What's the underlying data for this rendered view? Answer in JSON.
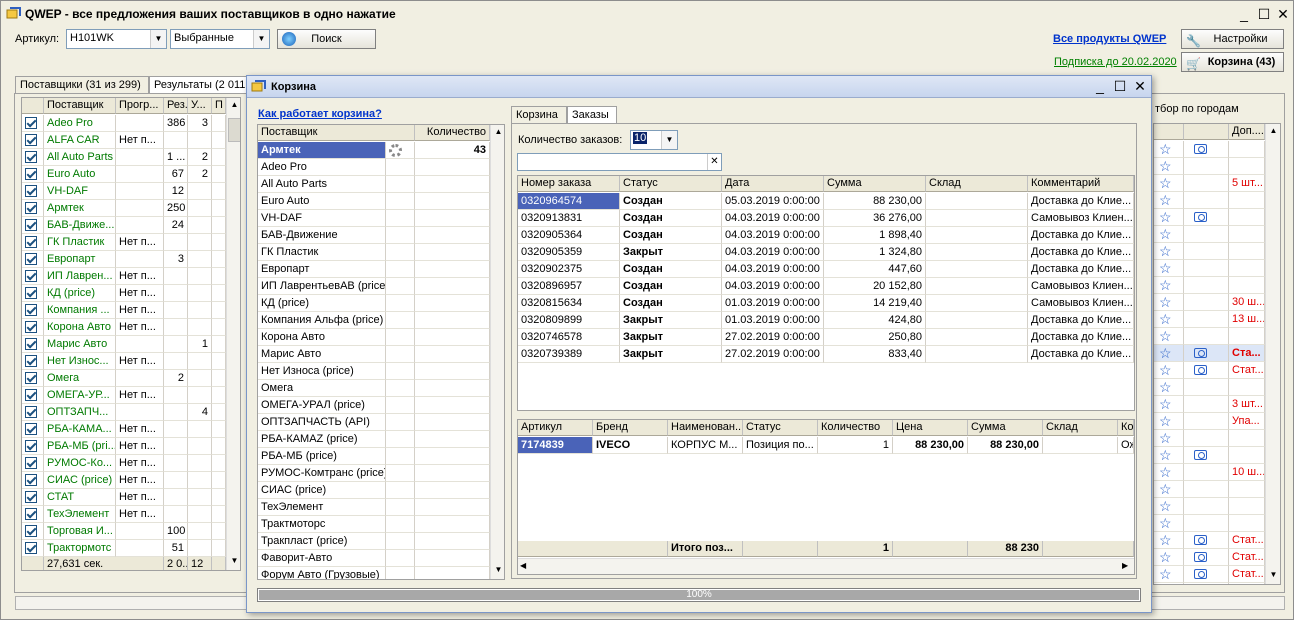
{
  "window": {
    "title": "QWEP - все предложения ваших поставщиков в одно нажатие"
  },
  "toolbar": {
    "article_label": "Артикул:",
    "article_value": "H101WK",
    "filter_value": "Выбранные",
    "search_label": "Поиск",
    "all_products_link": "Все продукты QWEP",
    "settings_label": "Настройки",
    "subscription_link": "Подписка до 20.02.2020",
    "cart_label": "Корзина (43)"
  },
  "main_tabs": [
    "Поставщики (31 из 299)",
    "Результаты (2 011"
  ],
  "suppliers_grid": {
    "headers": [
      "Поставщик",
      "Прогр...",
      "Рез...",
      "У...",
      "П"
    ],
    "rows": [
      {
        "name": "Adeo Pro",
        "prog": "",
        "res": "386",
        "u": "3"
      },
      {
        "name": "ALFA CAR",
        "prog": "Нет п...",
        "res": "",
        "u": ""
      },
      {
        "name": "All Auto Parts",
        "prog": "",
        "res": "1 ...",
        "u": "2"
      },
      {
        "name": "Euro Auto",
        "prog": "",
        "res": "67",
        "u": "2"
      },
      {
        "name": "VH-DAF",
        "prog": "",
        "res": "12",
        "u": ""
      },
      {
        "name": "Армтек",
        "prog": "",
        "res": "250",
        "u": ""
      },
      {
        "name": "БАВ-Движе...",
        "prog": "",
        "res": "24",
        "u": ""
      },
      {
        "name": "ГК Пластик",
        "prog": "Нет п...",
        "res": "",
        "u": ""
      },
      {
        "name": "Европарт",
        "prog": "",
        "res": "3",
        "u": ""
      },
      {
        "name": "ИП Лаврен...",
        "prog": "Нет п...",
        "res": "",
        "u": ""
      },
      {
        "name": "КД (price)",
        "prog": "Нет п...",
        "res": "",
        "u": ""
      },
      {
        "name": "Компания ...",
        "prog": "Нет п...",
        "res": "",
        "u": ""
      },
      {
        "name": "Корона Авто",
        "prog": "Нет п...",
        "res": "",
        "u": ""
      },
      {
        "name": "Марис Авто",
        "prog": "",
        "res": "",
        "u": "1"
      },
      {
        "name": "Нет Износ...",
        "prog": "Нет п...",
        "res": "",
        "u": ""
      },
      {
        "name": "Омега",
        "prog": "",
        "res": "2",
        "u": ""
      },
      {
        "name": "ОМЕГА-УР...",
        "prog": "Нет п...",
        "res": "",
        "u": ""
      },
      {
        "name": "ОПТЗАПЧ...",
        "prog": "",
        "res": "",
        "u": "4"
      },
      {
        "name": "РБА-КАМА...",
        "prog": "Нет п...",
        "res": "",
        "u": ""
      },
      {
        "name": "РБА-МБ (pri...",
        "prog": "Нет п...",
        "res": "",
        "u": ""
      },
      {
        "name": "РУМОС-Ко...",
        "prog": "Нет п...",
        "res": "",
        "u": ""
      },
      {
        "name": "СИАС (price)",
        "prog": "Нет п...",
        "res": "",
        "u": ""
      },
      {
        "name": "СТАТ",
        "prog": "Нет п...",
        "res": "",
        "u": ""
      },
      {
        "name": "ТехЭлемент",
        "prog": "Нет п...",
        "res": "",
        "u": ""
      },
      {
        "name": "Торговая И...",
        "prog": "",
        "res": "100",
        "u": ""
      },
      {
        "name": "Трактормотс",
        "prog": "",
        "res": "51",
        "u": ""
      }
    ],
    "footer": {
      "time": "27,631 сек.",
      "res": "2 0...",
      "u": "12"
    }
  },
  "right_panel": {
    "city_label": "тбор по городам",
    "header_col": "Доп....",
    "rows": [
      {
        "star": true,
        "cam": true,
        "text": "",
        "red": false
      },
      {
        "star": true,
        "cam": false,
        "text": "",
        "red": false
      },
      {
        "star": true,
        "cam": false,
        "text": "5 шт...",
        "red": true
      },
      {
        "star": true,
        "cam": false,
        "text": "",
        "red": false
      },
      {
        "star": true,
        "cam": true,
        "text": "",
        "red": false
      },
      {
        "star": true,
        "cam": false,
        "text": "",
        "red": false
      },
      {
        "star": true,
        "cam": false,
        "text": "",
        "red": false
      },
      {
        "star": true,
        "cam": false,
        "text": "",
        "red": false
      },
      {
        "star": true,
        "cam": false,
        "text": "",
        "red": false
      },
      {
        "star": true,
        "cam": false,
        "text": "30 ш...",
        "red": true
      },
      {
        "star": true,
        "cam": false,
        "text": "13 ш...",
        "red": true
      },
      {
        "star": true,
        "cam": false,
        "text": "",
        "red": false
      },
      {
        "star": true,
        "cam": true,
        "text": "Ста...",
        "red": true,
        "hl": true
      },
      {
        "star": true,
        "cam": true,
        "text": "Стат...",
        "red": true
      },
      {
        "star": true,
        "cam": false,
        "text": "",
        "red": false
      },
      {
        "star": true,
        "cam": false,
        "text": "3 шт...",
        "red": true
      },
      {
        "star": true,
        "cam": false,
        "text": "Упа...",
        "red": true
      },
      {
        "star": true,
        "cam": false,
        "text": "",
        "red": false
      },
      {
        "star": true,
        "cam": true,
        "text": "",
        "red": false
      },
      {
        "star": true,
        "cam": false,
        "text": "10 ш...",
        "red": true
      },
      {
        "star": true,
        "cam": false,
        "text": "",
        "red": false
      },
      {
        "star": true,
        "cam": false,
        "text": "",
        "red": false
      },
      {
        "star": true,
        "cam": false,
        "text": "",
        "red": false
      },
      {
        "star": true,
        "cam": true,
        "text": "Стат...",
        "red": true
      },
      {
        "star": true,
        "cam": true,
        "text": "Стат...",
        "red": true
      },
      {
        "star": true,
        "cam": true,
        "text": "Стат...",
        "red": true
      },
      {
        "star": true,
        "cam": false,
        "text": "",
        "red": false
      }
    ]
  },
  "cart": {
    "title": "Корзина",
    "how_link": "Как работает корзина?",
    "supplier_header": "Поставщик",
    "qty_header": "Количество",
    "suppliers": [
      {
        "name": "Армтек",
        "qty": "43",
        "selected": true
      },
      {
        "name": "Adeo Pro",
        "qty": ""
      },
      {
        "name": "All Auto Parts",
        "qty": ""
      },
      {
        "name": "Euro Auto",
        "qty": ""
      },
      {
        "name": "VH-DAF",
        "qty": ""
      },
      {
        "name": "БАВ-Движение",
        "qty": ""
      },
      {
        "name": "ГК Пластик",
        "qty": ""
      },
      {
        "name": "Европарт",
        "qty": ""
      },
      {
        "name": "ИП ЛаврентьевАВ (price)",
        "qty": ""
      },
      {
        "name": "КД (price)",
        "qty": ""
      },
      {
        "name": "Компания Альфа (price)",
        "qty": ""
      },
      {
        "name": "Корона Авто",
        "qty": ""
      },
      {
        "name": "Марис Авто",
        "qty": ""
      },
      {
        "name": "Нет Износа (price)",
        "qty": ""
      },
      {
        "name": "Омега",
        "qty": ""
      },
      {
        "name": "ОМЕГА-УРАЛ (price)",
        "qty": ""
      },
      {
        "name": "ОПТЗАПЧАСТЬ (API)",
        "qty": ""
      },
      {
        "name": "РБА-КАМАZ (price)",
        "qty": ""
      },
      {
        "name": "РБА-МБ (price)",
        "qty": ""
      },
      {
        "name": "РУМОС-Комтранс (price)",
        "qty": ""
      },
      {
        "name": "СИАС (price)",
        "qty": ""
      },
      {
        "name": "ТехЭлемент",
        "qty": ""
      },
      {
        "name": "Трактмоторс",
        "qty": ""
      },
      {
        "name": "Тракпласт (price)",
        "qty": ""
      },
      {
        "name": "Фаворит-Авто",
        "qty": ""
      },
      {
        "name": "Форум Авто (Грузовые)",
        "qty": ""
      }
    ],
    "tabs": [
      "Корзина",
      "Заказы"
    ],
    "orders_count_label": "Количество заказов:",
    "orders_count_value": "10",
    "orders_headers": [
      "Номер заказа",
      "Статус",
      "Дата",
      "Сумма",
      "Склад",
      "Комментарий"
    ],
    "orders": [
      {
        "num": "0320964574",
        "status": "Создан",
        "date": "05.03.2019 0:00:00",
        "sum": "88 230,00",
        "store": "",
        "comment": "Доставка до Клие..."
      },
      {
        "num": "0320913831",
        "status": "Создан",
        "date": "04.03.2019 0:00:00",
        "sum": "36 276,00",
        "store": "",
        "comment": "Самовывоз Клиен..."
      },
      {
        "num": "0320905364",
        "status": "Создан",
        "date": "04.03.2019 0:00:00",
        "sum": "1 898,40",
        "store": "",
        "comment": "Доставка до Клие..."
      },
      {
        "num": "0320905359",
        "status": "Закрыт",
        "date": "04.03.2019 0:00:00",
        "sum": "1 324,80",
        "store": "",
        "comment": "Доставка до Клие..."
      },
      {
        "num": "0320902375",
        "status": "Создан",
        "date": "04.03.2019 0:00:00",
        "sum": "447,60",
        "store": "",
        "comment": "Доставка до Клие..."
      },
      {
        "num": "0320896957",
        "status": "Создан",
        "date": "04.03.2019 0:00:00",
        "sum": "20 152,80",
        "store": "",
        "comment": "Самовывоз Клиен..."
      },
      {
        "num": "0320815634",
        "status": "Создан",
        "date": "01.03.2019 0:00:00",
        "sum": "14 219,40",
        "store": "",
        "comment": "Самовывоз Клиен..."
      },
      {
        "num": "0320809899",
        "status": "Закрыт",
        "date": "01.03.2019 0:00:00",
        "sum": "424,80",
        "store": "",
        "comment": "Доставка до Клие..."
      },
      {
        "num": "0320746578",
        "status": "Закрыт",
        "date": "27.02.2019 0:00:00",
        "sum": "250,80",
        "store": "",
        "comment": "Доставка до Клие..."
      },
      {
        "num": "0320739389",
        "status": "Закрыт",
        "date": "27.02.2019 0:00:00",
        "sum": "833,40",
        "store": "",
        "comment": "Доставка до Клие..."
      }
    ],
    "items_headers": [
      "Артикул",
      "Бренд",
      "Наименован...",
      "Статус",
      "Количество",
      "Цена",
      "Сумма",
      "Склад",
      "Ко"
    ],
    "items": [
      {
        "art": "7174839",
        "brand": "IVECO",
        "name": "КОРПУС М...",
        "status": "Позиция по...",
        "qty": "1",
        "price": "88 230,00",
        "sum": "88 230,00",
        "store": "",
        "co": "Ож"
      }
    ],
    "items_footer": {
      "label": "Итого поз...",
      "qty": "1",
      "sum": "88 230"
    },
    "progress": "100%"
  }
}
